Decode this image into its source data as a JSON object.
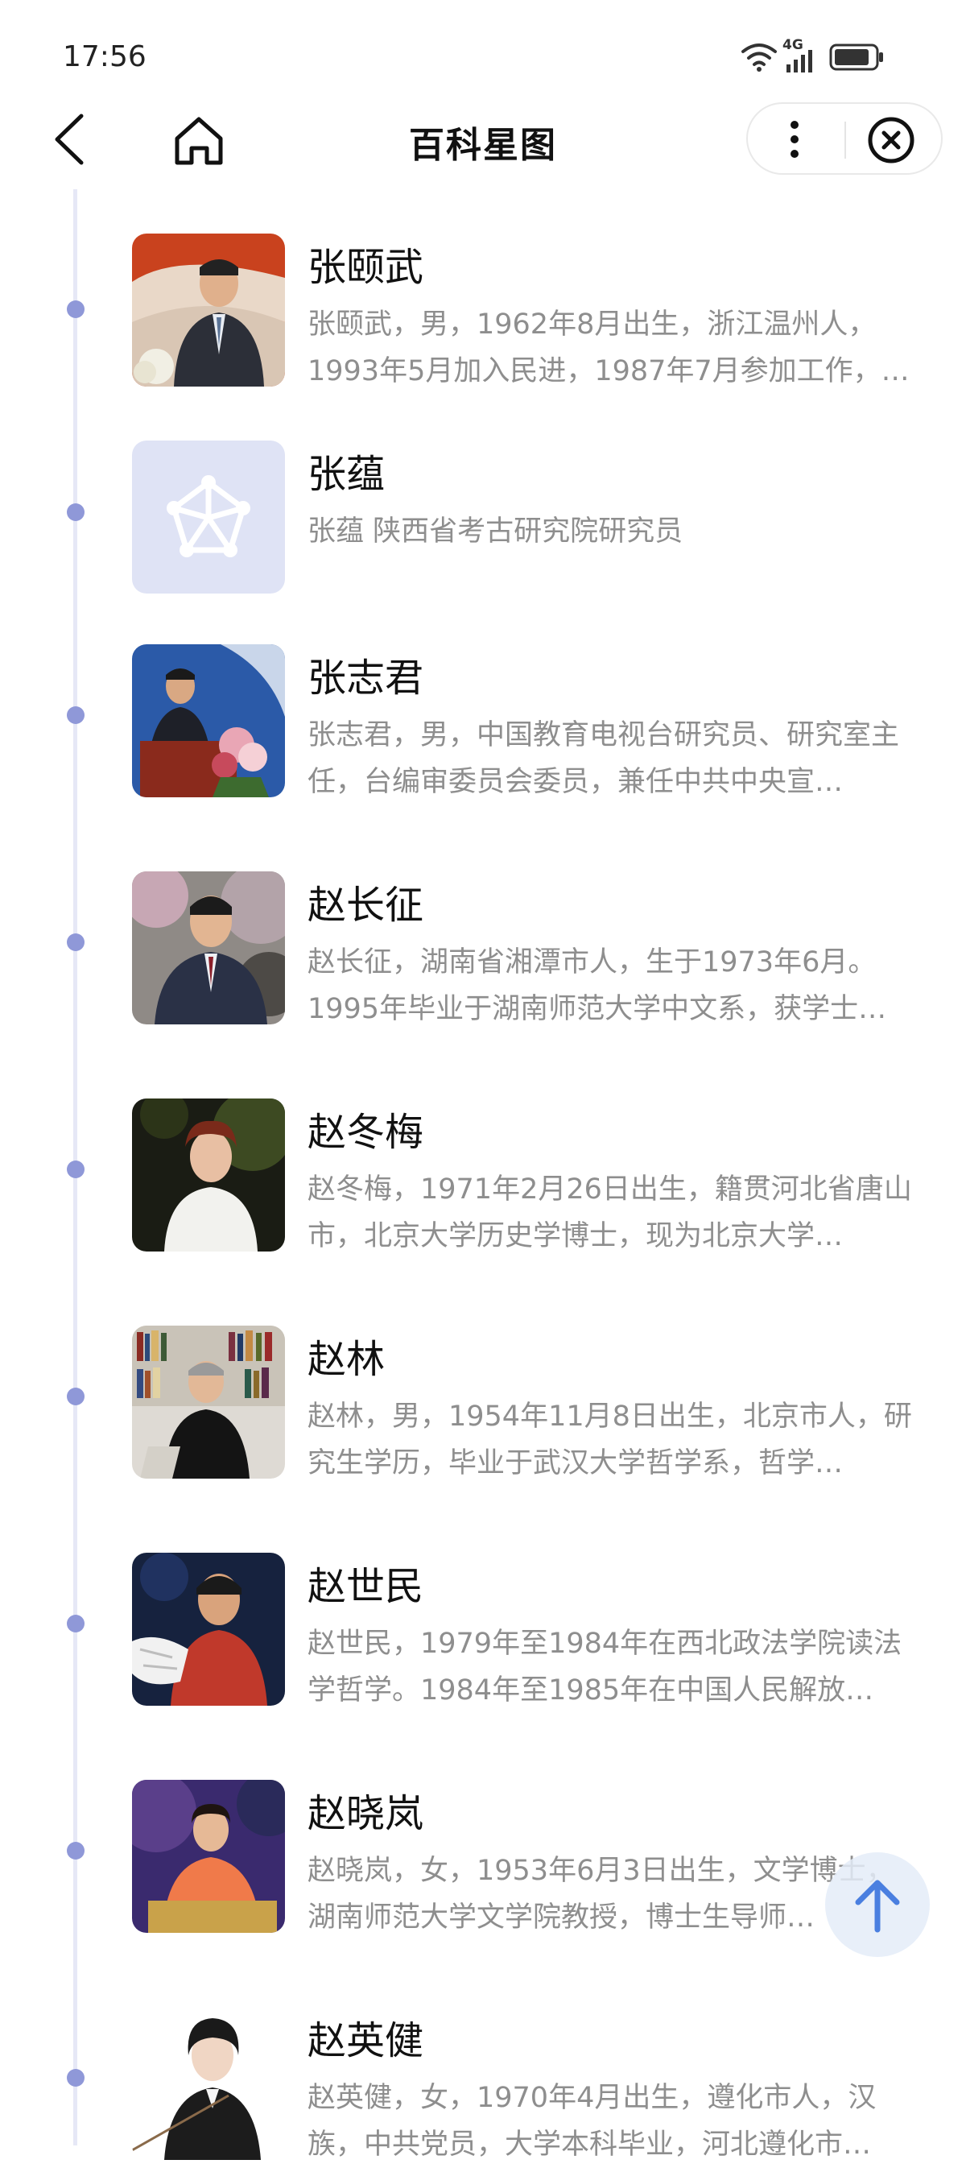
{
  "status_bar": {
    "time": "17:56",
    "network_label": "4G",
    "icons": [
      "wifi-icon",
      "signal-icon",
      "battery-icon"
    ]
  },
  "nav": {
    "title": "百科星图",
    "back_icon": "chevron-left-icon",
    "home_icon": "home-icon",
    "more_icon": "more-vertical-icon",
    "close_icon": "close-circle-icon"
  },
  "colors": {
    "timeline_line": "#e6e8f6",
    "timeline_dot": "#8f98d8",
    "desc_text": "#8e8e8e",
    "placeholder_bg": "#dfe3f5"
  },
  "items": [
    {
      "name": "张颐武",
      "desc": "张颐武，男，1962年8月出生，浙江温州人，1993年5月加入民进，1987年7月参加工作，…"
    },
    {
      "name": "张蕴",
      "desc": "张蕴 陕西省考古研究院研究员"
    },
    {
      "name": "张志君",
      "desc": "张志君，男，中国教育电视台研究员、研究室主任，台编审委员会委员，兼任中共中央宣…"
    },
    {
      "name": "赵长征",
      "desc": "赵长征，湖南省湘潭市人，生于1973年6月。1995年毕业于湖南师范大学中文系，获学士…"
    },
    {
      "name": "赵冬梅",
      "desc": "赵冬梅，1971年2月26日出生，籍贯河北省唐山市，北京大学历史学博士，现为北京大学…"
    },
    {
      "name": "赵林",
      "desc": "赵林，男，1954年11月8日出生，北京市人，研究生学历，毕业于武汉大学哲学系，哲学…"
    },
    {
      "name": "赵世民",
      "desc": "赵世民，1979年至1984年在西北政法学院读法学哲学。1984年至1985年在中国人民解放…"
    },
    {
      "name": "赵晓岚",
      "desc": "赵晓岚，女，1953年6月3日出生，文学博士，湖南师范大学文学院教授，博士生导师…"
    },
    {
      "name": "赵英健",
      "desc": "赵英健，女，1970年4月出生，遵化市人，汉族，中共党员，大学本科毕业，河北遵化市…"
    }
  ],
  "scroll_top_icon": "arrow-up-icon"
}
